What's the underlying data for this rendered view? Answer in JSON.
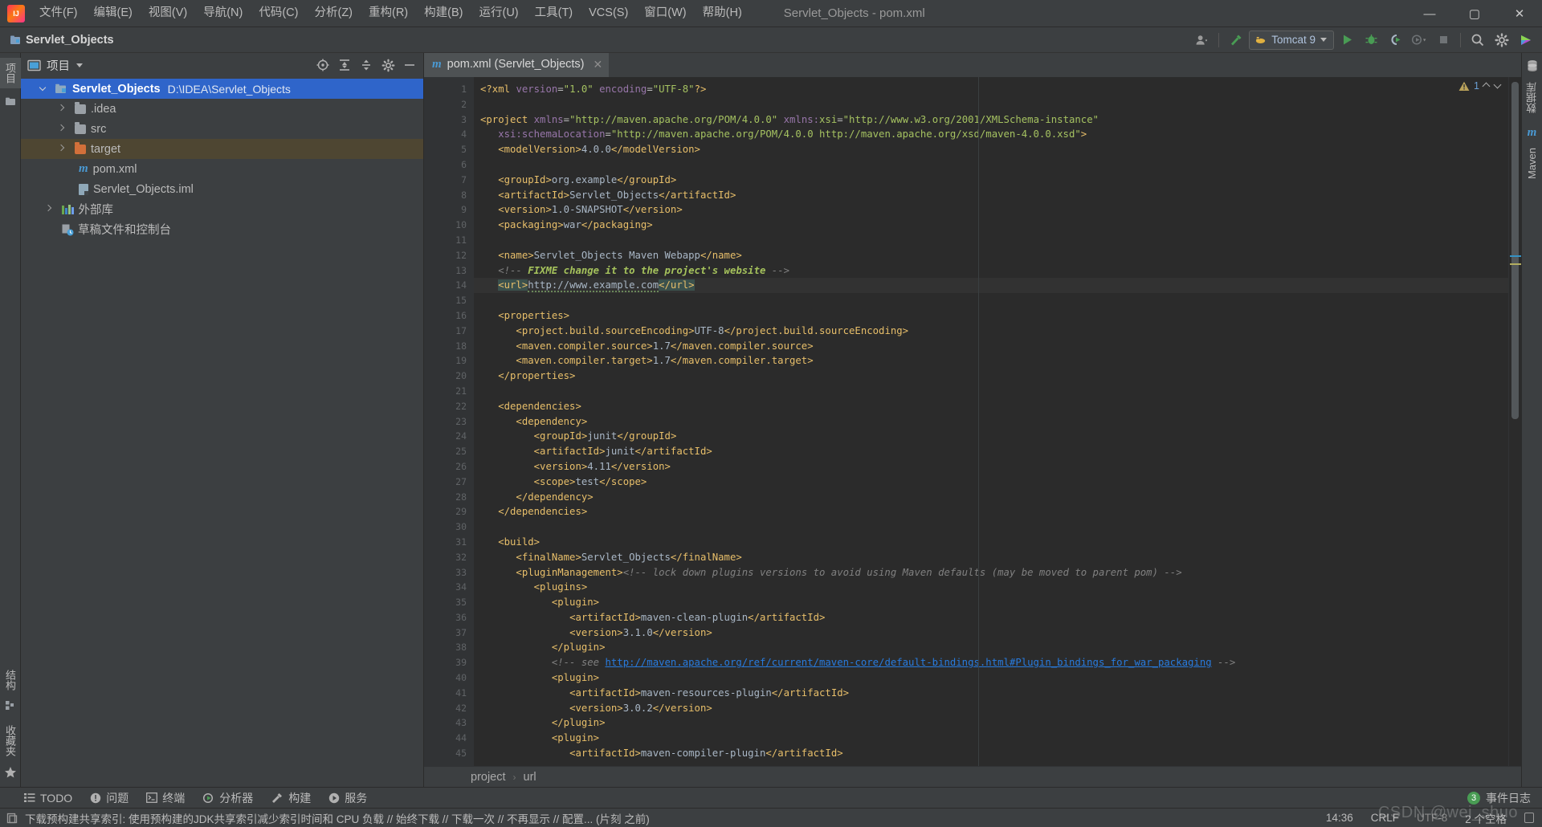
{
  "window": {
    "title": "Servlet_Objects - pom.xml",
    "minimize_label": "—",
    "maximize_label": "▢",
    "close_label": "✕"
  },
  "menu": [
    {
      "label": "文件(F)",
      "name": "menu-file"
    },
    {
      "label": "编辑(E)",
      "name": "menu-edit"
    },
    {
      "label": "视图(V)",
      "name": "menu-view"
    },
    {
      "label": "导航(N)",
      "name": "menu-navigate"
    },
    {
      "label": "代码(C)",
      "name": "menu-code"
    },
    {
      "label": "分析(Z)",
      "name": "menu-analyze"
    },
    {
      "label": "重构(R)",
      "name": "menu-refactor"
    },
    {
      "label": "构建(B)",
      "name": "menu-build"
    },
    {
      "label": "运行(U)",
      "name": "menu-run"
    },
    {
      "label": "工具(T)",
      "name": "menu-tools"
    },
    {
      "label": "VCS(S)",
      "name": "menu-vcs"
    },
    {
      "label": "窗口(W)",
      "name": "menu-window"
    },
    {
      "label": "帮助(H)",
      "name": "menu-help"
    }
  ],
  "toolbar": {
    "project_name": "Servlet_Objects",
    "run_config": "Tomcat 9",
    "icons": {
      "user": "user-icon",
      "build_hammer": "hammer-icon",
      "run": "run-icon",
      "debug": "debug-icon",
      "run_coverage": "run-with-coverage-icon",
      "profiler": "profiler-icon",
      "stop": "stop-icon",
      "search": "search-everywhere-icon",
      "settings": "settings-icon",
      "updates": "updates-icon"
    }
  },
  "left_strip": {
    "tabs": [
      {
        "label": "项目",
        "name": "tool-tab-project",
        "active": true
      },
      {
        "label": "",
        "name": "tool-tab-bookmarks",
        "active": false
      }
    ],
    "bottom_tabs": [
      {
        "label": "结构",
        "name": "tool-tab-structure"
      },
      {
        "label": "收藏夹",
        "name": "tool-tab-favorites"
      }
    ]
  },
  "right_strip": {
    "tabs": [
      {
        "label": "数据库",
        "name": "tool-tab-database"
      },
      {
        "label": "Maven",
        "name": "tool-tab-maven"
      }
    ]
  },
  "project_panel": {
    "title": "项目",
    "header_icons": [
      "locate-icon",
      "expand-all-icon",
      "collapse-all-icon",
      "gear-icon",
      "hide-icon"
    ],
    "tree": [
      {
        "name": "Servlet_Objects",
        "path": "D:\\IDEA\\Servlet_Objects",
        "icon": "module-folder-icon",
        "state": "expanded",
        "indent": 0,
        "selected": true
      },
      {
        "name": ".idea",
        "path": "",
        "icon": "folder-icon",
        "state": "collapsed",
        "indent": 1,
        "selected": false
      },
      {
        "name": "src",
        "path": "",
        "icon": "folder-icon",
        "state": "collapsed",
        "indent": 1,
        "selected": false
      },
      {
        "name": "target",
        "path": "",
        "icon": "folder-excluded-icon",
        "state": "collapsed",
        "indent": 1,
        "selected": false,
        "highlighted": true
      },
      {
        "name": "pom.xml",
        "path": "",
        "icon": "maven-file-icon",
        "state": "leaf",
        "indent": 1,
        "selected": false
      },
      {
        "name": "Servlet_Objects.iml",
        "path": "",
        "icon": "iml-file-icon",
        "state": "leaf",
        "indent": 1,
        "selected": false
      },
      {
        "name": "外部库",
        "path": "",
        "icon": "library-icon",
        "state": "collapsed",
        "indent": 0,
        "selected": false
      },
      {
        "name": "草稿文件和控制台",
        "path": "",
        "icon": "scratches-icon",
        "state": "leaf",
        "indent": 0,
        "selected": false
      }
    ]
  },
  "editor": {
    "tab": {
      "label": "pom.xml (Servlet_Objects)",
      "icon": "maven-file-icon",
      "close": "✕"
    },
    "inspection": {
      "icon": "warning-triangle-icon",
      "count": "1",
      "up": "prev-problem-icon",
      "down": "next-problem-icon"
    },
    "caret_line": 14,
    "lines": [
      {
        "n": 1,
        "fold": "",
        "html": "<span class=\"tag\">&lt;?xml</span> <span class=\"attrname\">version</span><span class=\"attr\">=</span><span class=\"val\">\"1.0\"</span> <span class=\"attrname\">encoding</span><span class=\"attr\">=</span><span class=\"val\">\"UTF-8\"</span><span class=\"tag\">?&gt;</span>"
      },
      {
        "n": 2,
        "fold": "",
        "html": ""
      },
      {
        "n": 3,
        "fold": "open",
        "html": "<span class=\"tag\">&lt;project</span> <span class=\"attrname\">xmlns</span><span class=\"attr\">=</span><span class=\"val\">\"http://maven.apache.org/POM/4.0.0\"</span> <span class=\"attrname\">xmlns:</span><span class=\"val\">xsi</span><span class=\"attr\">=</span><span class=\"val\">\"http://www.w3.org/2001/XMLSchema-instance\"</span>"
      },
      {
        "n": 4,
        "fold": "",
        "html": "   <span class=\"attrname\">xsi:schemaLocation</span><span class=\"attr\">=</span><span class=\"val\">\"http://maven.apache.org/POM/4.0.0 http://maven.apache.org/xsd/maven-4.0.0.xsd\"</span><span class=\"tag\">&gt;</span>"
      },
      {
        "n": 5,
        "fold": "",
        "html": "   <span class=\"tag\">&lt;modelVersion&gt;</span><span class=\"txt\">4.0.0</span><span class=\"tag\">&lt;/modelVersion&gt;</span>"
      },
      {
        "n": 6,
        "fold": "",
        "html": ""
      },
      {
        "n": 7,
        "fold": "",
        "html": "   <span class=\"tag\">&lt;groupId&gt;</span><span class=\"txt\">org.example</span><span class=\"tag\">&lt;/groupId&gt;</span>"
      },
      {
        "n": 8,
        "fold": "",
        "html": "   <span class=\"tag\">&lt;artifactId&gt;</span><span class=\"txt\">Servlet_Objects</span><span class=\"tag\">&lt;/artifactId&gt;</span>"
      },
      {
        "n": 9,
        "fold": "",
        "html": "   <span class=\"tag\">&lt;version&gt;</span><span class=\"txt\">1.0-SNAPSHOT</span><span class=\"tag\">&lt;/version&gt;</span>"
      },
      {
        "n": 10,
        "fold": "",
        "html": "   <span class=\"tag\">&lt;packaging&gt;</span><span class=\"txt\">war</span><span class=\"tag\">&lt;/packaging&gt;</span>"
      },
      {
        "n": 11,
        "fold": "",
        "html": ""
      },
      {
        "n": 12,
        "fold": "",
        "html": "   <span class=\"tag\">&lt;name&gt;</span><span class=\"txt\">Servlet_Objects Maven Webapp</span><span class=\"tag\">&lt;/name&gt;</span>"
      },
      {
        "n": 13,
        "fold": "",
        "html": "   <span class=\"comment\">&lt;!-- </span><span class=\"fixme\">FIXME change it to the project's website</span><span class=\"comment\"> --&gt;</span>"
      },
      {
        "n": 14,
        "fold": "",
        "caret": true,
        "html": "   <span class=\"hl-tag tag\">&lt;url&gt;</span><span class=\"txt squig\">http://www.example.com</span><span class=\"hl-tag tag\">&lt;/url&gt;</span>"
      },
      {
        "n": 15,
        "fold": "",
        "html": ""
      },
      {
        "n": 16,
        "fold": "open",
        "html": "   <span class=\"tag\">&lt;properties&gt;</span>"
      },
      {
        "n": 17,
        "fold": "",
        "html": "      <span class=\"tag\">&lt;project.build.sourceEncoding&gt;</span><span class=\"txt\">UTF-8</span><span class=\"tag\">&lt;/project.build.sourceEncoding&gt;</span>"
      },
      {
        "n": 18,
        "fold": "",
        "html": "      <span class=\"tag\">&lt;maven.compiler.source&gt;</span><span class=\"txt\">1.7</span><span class=\"tag\">&lt;/maven.compiler.source&gt;</span>"
      },
      {
        "n": 19,
        "fold": "",
        "html": "      <span class=\"tag\">&lt;maven.compiler.target&gt;</span><span class=\"txt\">1.7</span><span class=\"tag\">&lt;/maven.compiler.target&gt;</span>"
      },
      {
        "n": 20,
        "fold": "close",
        "html": "   <span class=\"tag\">&lt;/properties&gt;</span>"
      },
      {
        "n": 21,
        "fold": "",
        "html": ""
      },
      {
        "n": 22,
        "fold": "open",
        "html": "   <span class=\"tag\">&lt;dependencies&gt;</span>"
      },
      {
        "n": 23,
        "fold": "open",
        "html": "      <span class=\"tag\">&lt;dependency&gt;</span>"
      },
      {
        "n": 24,
        "fold": "",
        "html": "         <span class=\"tag\">&lt;groupId&gt;</span><span class=\"txt\">junit</span><span class=\"tag\">&lt;/groupId&gt;</span>"
      },
      {
        "n": 25,
        "fold": "",
        "html": "         <span class=\"tag\">&lt;artifactId&gt;</span><span class=\"txt\">junit</span><span class=\"tag\">&lt;/artifactId&gt;</span>"
      },
      {
        "n": 26,
        "fold": "",
        "html": "         <span class=\"tag\">&lt;version&gt;</span><span class=\"txt\">4.11</span><span class=\"tag\">&lt;/version&gt;</span>"
      },
      {
        "n": 27,
        "fold": "",
        "html": "         <span class=\"tag\">&lt;scope&gt;</span><span class=\"txt\">test</span><span class=\"tag\">&lt;/scope&gt;</span>"
      },
      {
        "n": 28,
        "fold": "close",
        "html": "      <span class=\"tag\">&lt;/dependency&gt;</span>"
      },
      {
        "n": 29,
        "fold": "close",
        "html": "   <span class=\"tag\">&lt;/dependencies&gt;</span>"
      },
      {
        "n": 30,
        "fold": "",
        "html": ""
      },
      {
        "n": 31,
        "fold": "open",
        "html": "   <span class=\"tag\">&lt;build&gt;</span>"
      },
      {
        "n": 32,
        "fold": "",
        "html": "      <span class=\"tag\">&lt;finalName&gt;</span><span class=\"txt\">Servlet_Objects</span><span class=\"tag\">&lt;/finalName&gt;</span>"
      },
      {
        "n": 33,
        "fold": "open",
        "html": "      <span class=\"tag\">&lt;pluginManagement&gt;</span><span class=\"comment\">&lt;!-- lock down plugins versions to avoid using Maven defaults (may be moved to parent pom) --&gt;</span>"
      },
      {
        "n": 34,
        "fold": "open",
        "html": "         <span class=\"tag\">&lt;plugins&gt;</span>"
      },
      {
        "n": 35,
        "fold": "open",
        "html": "            <span class=\"tag\">&lt;plugin&gt;</span>"
      },
      {
        "n": 36,
        "fold": "",
        "html": "               <span class=\"tag\">&lt;artifactId&gt;</span><span class=\"txt\">maven-clean-plugin</span><span class=\"tag\">&lt;/artifactId&gt;</span>"
      },
      {
        "n": 37,
        "fold": "",
        "html": "               <span class=\"tag\">&lt;version&gt;</span><span class=\"txt\">3.1.0</span><span class=\"tag\">&lt;/version&gt;</span>"
      },
      {
        "n": 38,
        "fold": "close",
        "html": "            <span class=\"tag\">&lt;/plugin&gt;</span>"
      },
      {
        "n": 39,
        "fold": "",
        "html": "            <span class=\"comment\">&lt;!-- see </span><span class=\"lnk\">http://maven.apache.org/ref/current/maven-core/default-bindings.html#Plugin_bindings_for_war_packaging</span><span class=\"comment\"> --&gt;</span>"
      },
      {
        "n": 40,
        "fold": "open",
        "html": "            <span class=\"tag\">&lt;plugin&gt;</span>"
      },
      {
        "n": 41,
        "fold": "",
        "html": "               <span class=\"tag\">&lt;artifactId&gt;</span><span class=\"txt\">maven-resources-plugin</span><span class=\"tag\">&lt;/artifactId&gt;</span>"
      },
      {
        "n": 42,
        "fold": "",
        "html": "               <span class=\"tag\">&lt;version&gt;</span><span class=\"txt\">3.0.2</span><span class=\"tag\">&lt;/version&gt;</span>"
      },
      {
        "n": 43,
        "fold": "close",
        "html": "            <span class=\"tag\">&lt;/plugin&gt;</span>"
      },
      {
        "n": 44,
        "fold": "open",
        "html": "            <span class=\"tag\">&lt;plugin&gt;</span>"
      },
      {
        "n": 45,
        "fold": "",
        "html": "               <span class=\"tag\">&lt;artifactId&gt;</span><span class=\"txt\">maven-compiler-plugin</span><span class=\"tag\">&lt;/artifactId&gt;</span>"
      }
    ],
    "breadcrumb": [
      "project",
      "url"
    ],
    "breadcrumb_sep": "›"
  },
  "bottom_tools": [
    {
      "label": "TODO",
      "name": "tool-window-todo",
      "icon": "todo-icon"
    },
    {
      "label": "问题",
      "name": "tool-window-problems",
      "icon": "problems-icon"
    },
    {
      "label": "终端",
      "name": "tool-window-terminal",
      "icon": "terminal-icon"
    },
    {
      "label": "分析器",
      "name": "tool-window-profiler",
      "icon": "profiler-icon"
    },
    {
      "label": "构建",
      "name": "tool-window-build",
      "icon": "hammer-icon"
    },
    {
      "label": "服务",
      "name": "tool-window-services",
      "icon": "services-icon"
    }
  ],
  "event_log": {
    "label": "事件日志",
    "badge": "3"
  },
  "statusbar": {
    "message": "下载预构建共享索引: 使用预构建的JDK共享索引减少索引时间和 CPU 负载 // 始终下载 // 下载一次 // 不再显示 // 配置... (片刻 之前)",
    "time": "14:36",
    "line_separator": "CRLF",
    "encoding": "UTF-8",
    "indent": "2 个空格",
    "lock_icon": "lock-icon"
  },
  "watermark": "CSDN @wei_shuo",
  "colors": {
    "accent_blue": "#2f65ca",
    "editor_bg": "#2b2b2b",
    "panel_bg": "#3c3f41",
    "gutter_bg": "#313335",
    "tag": "#e8bf6a",
    "value": "#a5c261",
    "text": "#a9b7c6",
    "comment": "#808080",
    "badge_green": "#499c54",
    "warning": "#bba35a"
  }
}
